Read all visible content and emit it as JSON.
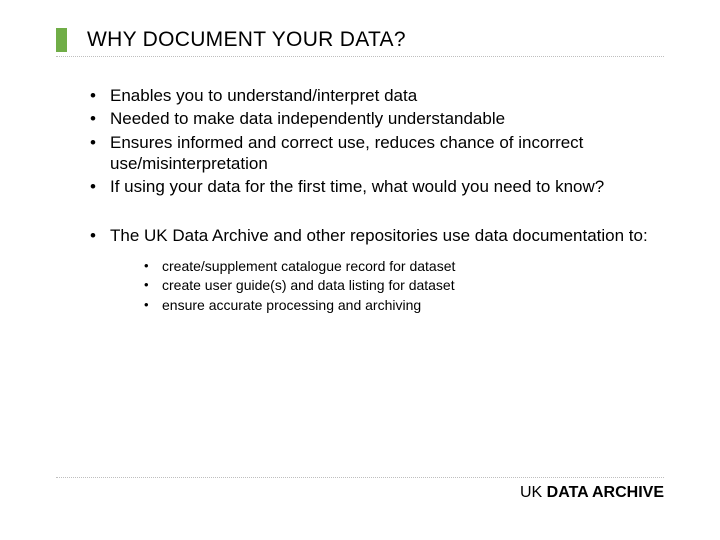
{
  "title": "WHY DOCUMENT YOUR DATA?",
  "bullets_a": [
    "Enables you to understand/interpret data",
    "Needed to make data independently understandable",
    "Ensures informed and correct use, reduces chance of incorrect use/misinterpretation",
    "If using your data for the first time, what would you need to know?"
  ],
  "bullets_b_lead": "The UK Data Archive and other repositories use data documentation to:",
  "sub_bullets": [
    "create/supplement catalogue record for dataset",
    "create user guide(s) and data listing for dataset",
    "ensure accurate processing and archiving"
  ],
  "footer_light": "UK ",
  "footer_bold": "DATA ARCHIVE"
}
